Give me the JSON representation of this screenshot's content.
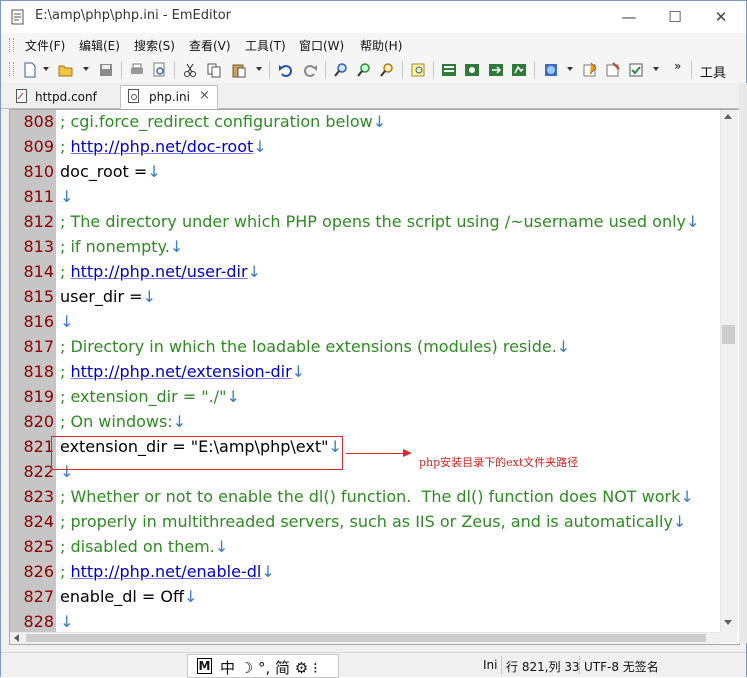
{
  "window": {
    "title": "E:\\amp\\php\\php.ini - EmEditor",
    "minimize_glyph": "—",
    "maximize_glyph": "☐",
    "close_glyph": "✕"
  },
  "menu": {
    "items": [
      "文件(F)",
      "编辑(E)",
      "搜索(S)",
      "查看(V)",
      "工具(T)",
      "窗口(W)",
      "帮助(H)"
    ]
  },
  "toolbar": {
    "overflow_glyph": "»",
    "tools_label": "工具",
    "icons": [
      "new-file-icon",
      "open-folder-icon",
      "save-icon",
      "print-icon",
      "print-preview-icon",
      "cut-icon",
      "copy-icon",
      "paste-icon",
      "undo-icon",
      "redo-icon",
      "find-icon",
      "find-next-icon",
      "replace-icon",
      "highlight-icon",
      "toggle-icon-1",
      "toggle-icon-2",
      "toggle-icon-3",
      "toggle-icon-4",
      "web-icon",
      "properties-icon",
      "config-icon",
      "checklist-icon"
    ]
  },
  "tabs": [
    {
      "label": "httpd.conf"
    },
    {
      "label": "php.ini",
      "close_glyph": "×",
      "active": true
    }
  ],
  "eol_marker": "↓",
  "editor": {
    "lines": [
      {
        "num": "808",
        "text": "; cgi.force_redirect configuration below",
        "kind": "comment"
      },
      {
        "num": "809",
        "prefix": "; ",
        "url": "http://php.net/doc-root",
        "kind": "url"
      },
      {
        "num": "810",
        "text": "doc_root =",
        "kind": "code"
      },
      {
        "num": "811",
        "text": "",
        "kind": "code"
      },
      {
        "num": "812",
        "text": "; The directory under which PHP opens the script using /~username used only",
        "kind": "comment"
      },
      {
        "num": "813",
        "text": "; if nonempty.",
        "kind": "comment"
      },
      {
        "num": "814",
        "prefix": "; ",
        "url": "http://php.net/user-dir",
        "kind": "url"
      },
      {
        "num": "815",
        "text": "user_dir =",
        "kind": "code"
      },
      {
        "num": "816",
        "text": "",
        "kind": "code"
      },
      {
        "num": "817",
        "text": "; Directory in which the loadable extensions (modules) reside.",
        "kind": "comment"
      },
      {
        "num": "818",
        "prefix": "; ",
        "url": "http://php.net/extension-dir",
        "kind": "url"
      },
      {
        "num": "819",
        "text": "; extension_dir = \"./\"",
        "kind": "comment"
      },
      {
        "num": "820",
        "text": "; On windows:",
        "kind": "comment"
      },
      {
        "num": "821",
        "text": "extension_dir = \"E:\\amp\\php\\ext\"",
        "kind": "code"
      },
      {
        "num": "822",
        "text": "",
        "kind": "code"
      },
      {
        "num": "823",
        "text": "; Whether or not to enable the dl() function.  The dl() function does NOT work",
        "kind": "comment"
      },
      {
        "num": "824",
        "text": "; properly in multithreaded servers, such as IIS or Zeus, and is automatically",
        "kind": "comment"
      },
      {
        "num": "825",
        "text": "; disabled on them.",
        "kind": "comment"
      },
      {
        "num": "826",
        "prefix": "; ",
        "url": "http://php.net/enable-dl",
        "kind": "url"
      },
      {
        "num": "827",
        "text": "enable_dl = Off",
        "kind": "code"
      },
      {
        "num": "828",
        "text": "",
        "kind": "code"
      }
    ]
  },
  "annotation": {
    "text": "php安装目录下的ext文件夹路径",
    "color": "#e0282a"
  },
  "status": {
    "ime_m": "M",
    "ime_text": "中 ☽ °, 简 ⚙ ⁝",
    "mode": "Ini",
    "position": "行 821,列 33",
    "encoding": "UTF-8 无签名"
  },
  "colors": {
    "comment": "#2e8b22",
    "url": "#0000cc",
    "line_number": "#8b0000",
    "eol_marker": "#3a7bbf"
  }
}
